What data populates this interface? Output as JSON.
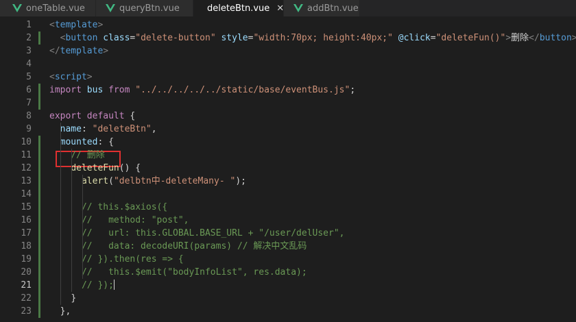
{
  "tabs": [
    {
      "label": "oneTable.vue",
      "active": false
    },
    {
      "label": "queryBtn.vue",
      "active": false
    },
    {
      "label": "deleteBtn.vue",
      "active": true,
      "close": "✕"
    },
    {
      "label": "addBtn.vue",
      "active": false
    }
  ],
  "colors": {
    "vue_green": "#41b883",
    "tag": "#569cd6",
    "attr": "#9cdcfe",
    "string": "#ce9178",
    "keyword": "#c586c0",
    "func": "#dcdcaa",
    "comment": "#6a9955",
    "plain": "#d4d4d4",
    "highlight_border": "#e03030"
  },
  "lines": [
    {
      "n": "1",
      "tokens": [
        [
          "<",
          "tag-dim"
        ],
        [
          "template",
          "tag"
        ],
        [
          ">",
          "tag-dim"
        ]
      ]
    },
    {
      "n": "2",
      "tokens": [
        [
          "  ",
          "plain"
        ],
        [
          "<",
          "tag-dim"
        ],
        [
          "button",
          "tag"
        ],
        [
          " ",
          "plain"
        ],
        [
          "class",
          "attr"
        ],
        [
          "=",
          "plain"
        ],
        [
          "\"delete-button\"",
          "string"
        ],
        [
          " ",
          "plain"
        ],
        [
          "style",
          "attr"
        ],
        [
          "=",
          "plain"
        ],
        [
          "\"width:70px; height:40px;\"",
          "string"
        ],
        [
          " ",
          "plain"
        ],
        [
          "@click",
          "attr"
        ],
        [
          "=",
          "plain"
        ],
        [
          "\"deleteFun()\"",
          "string"
        ],
        [
          ">",
          "tag-dim"
        ],
        [
          "删除",
          "plain"
        ],
        [
          "</",
          "tag-dim"
        ],
        [
          "button",
          "tag"
        ],
        [
          ">",
          "tag-dim"
        ]
      ]
    },
    {
      "n": "3",
      "tokens": [
        [
          "</",
          "tag-dim"
        ],
        [
          "template",
          "tag"
        ],
        [
          ">",
          "tag-dim"
        ]
      ]
    },
    {
      "n": "4",
      "tokens": []
    },
    {
      "n": "5",
      "tokens": [
        [
          "<",
          "tag-dim"
        ],
        [
          "script",
          "tag"
        ],
        [
          ">",
          "tag-dim"
        ]
      ]
    },
    {
      "n": "6",
      "tokens": [
        [
          "import",
          "keyword"
        ],
        [
          " ",
          "plain"
        ],
        [
          "bus",
          "attr"
        ],
        [
          " ",
          "plain"
        ],
        [
          "from",
          "keyword"
        ],
        [
          " ",
          "plain"
        ],
        [
          "\"../../../../../static/base/eventBus.js\"",
          "string"
        ],
        [
          ";",
          "plain"
        ]
      ]
    },
    {
      "n": "7",
      "tokens": []
    },
    {
      "n": "8",
      "tokens": [
        [
          "export",
          "keyword"
        ],
        [
          " ",
          "plain"
        ],
        [
          "default",
          "keyword"
        ],
        [
          " {",
          "plain"
        ]
      ]
    },
    {
      "n": "9",
      "tokens": [
        [
          "  ",
          "plain"
        ],
        [
          "name",
          "attr"
        ],
        [
          ": ",
          "plain"
        ],
        [
          "\"deleteBtn\"",
          "string"
        ],
        [
          ",",
          "plain"
        ]
      ]
    },
    {
      "n": "10",
      "tokens": [
        [
          "  ",
          "plain"
        ],
        [
          "mounted",
          "attr"
        ],
        [
          ": {",
          "plain"
        ]
      ]
    },
    {
      "n": "11",
      "tokens": [
        [
          "    ",
          "plain"
        ],
        [
          "// 删除",
          "comment"
        ]
      ]
    },
    {
      "n": "12",
      "tokens": [
        [
          "    ",
          "plain"
        ],
        [
          "deleteFun",
          "func"
        ],
        [
          "() {",
          "plain"
        ]
      ]
    },
    {
      "n": "13",
      "tokens": [
        [
          "      ",
          "plain"
        ],
        [
          "alert",
          "func"
        ],
        [
          "(",
          "plain"
        ],
        [
          "\"delbtn中-deleteMany- \"",
          "string"
        ],
        [
          ");",
          "plain"
        ]
      ]
    },
    {
      "n": "14",
      "tokens": []
    },
    {
      "n": "15",
      "tokens": [
        [
          "      ",
          "plain"
        ],
        [
          "// this.$axios({",
          "comment"
        ]
      ]
    },
    {
      "n": "16",
      "tokens": [
        [
          "      ",
          "plain"
        ],
        [
          "//   method: \"post\",",
          "comment"
        ]
      ]
    },
    {
      "n": "17",
      "tokens": [
        [
          "      ",
          "plain"
        ],
        [
          "//   url: this.GLOBAL.BASE_URL + \"/user/delUser\",",
          "comment"
        ]
      ]
    },
    {
      "n": "18",
      "tokens": [
        [
          "      ",
          "plain"
        ],
        [
          "//   data: decodeURI(params) // 解决中文乱码",
          "comment"
        ]
      ]
    },
    {
      "n": "19",
      "tokens": [
        [
          "      ",
          "plain"
        ],
        [
          "// }).then(res => {",
          "comment"
        ]
      ]
    },
    {
      "n": "20",
      "tokens": [
        [
          "      ",
          "plain"
        ],
        [
          "//   this.$emit(\"bodyInfoList\", res.data);",
          "comment"
        ]
      ]
    },
    {
      "n": "21",
      "tokens": [
        [
          "      ",
          "plain"
        ],
        [
          "// });",
          "comment"
        ]
      ],
      "active": true
    },
    {
      "n": "22",
      "tokens": [
        [
          "    ",
          "plain"
        ],
        [
          "}",
          "plain"
        ]
      ]
    },
    {
      "n": "23",
      "tokens": [
        [
          "  ",
          "plain"
        ],
        [
          "},",
          "plain"
        ]
      ]
    }
  ]
}
